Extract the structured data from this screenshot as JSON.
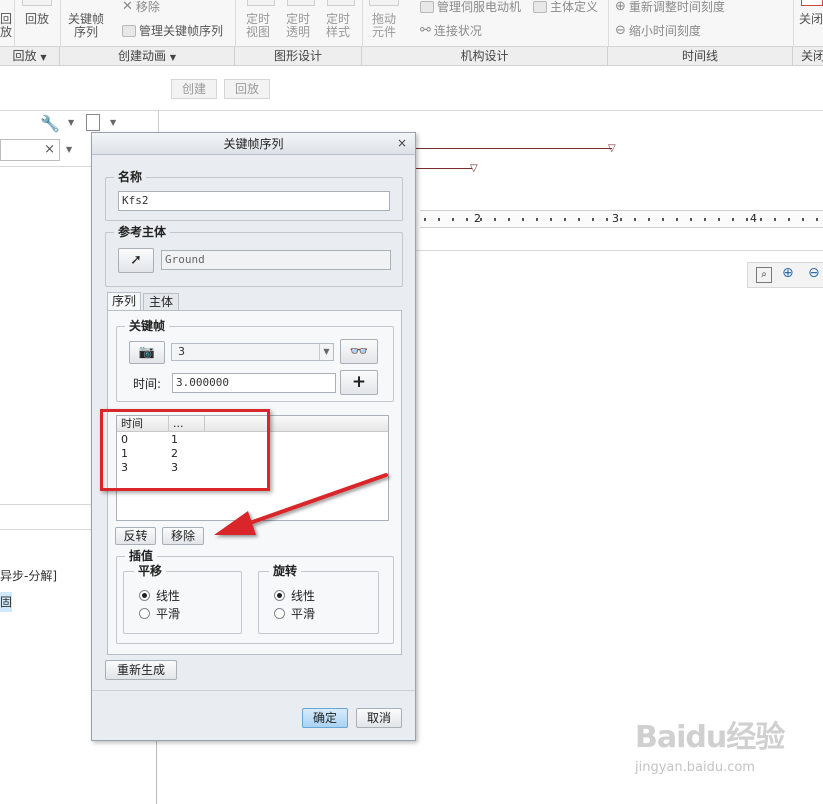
{
  "ribbon": {
    "playback_top": "回\n放",
    "playback": "回放",
    "keyframe_seq": "关键帧\n序列",
    "remove": "移除",
    "manage_keyframe_seq": "管理关键帧序列",
    "fixed_view": "定时\n视图",
    "fixed_transparency": "定时\n透明",
    "fixed_style": "定时\n样式",
    "drag_component": "拖动\n元件",
    "manage_servo": "管理伺服电动机",
    "body_def": "主体定义",
    "connection_status": "连接状况",
    "rescale_time": "重新调整时间刻度",
    "shrink_time": "缩小时间刻度",
    "close": "关闭",
    "groups": [
      "回放",
      "创建动画",
      "图形设计",
      "机构设计",
      "时间线",
      "关闭"
    ]
  },
  "toolbar2": {
    "create": "创建",
    "playback": "回放"
  },
  "left": {
    "text1": "异步-分解]",
    "text2": "固"
  },
  "timeline": {
    "ticks": [
      "2",
      "3",
      "4"
    ]
  },
  "dialog": {
    "title": "关键帧序列",
    "close_glyph": "×",
    "name_label": "名称",
    "name_value": "Kfs2",
    "ref_label": "参考主体",
    "ref_value": "Ground",
    "tabs": [
      "序列",
      "主体"
    ],
    "keyframe_label": "关键帧",
    "keyframe_value": "3",
    "time_label": "时间:",
    "time_value": "3.000000",
    "table": {
      "headers": [
        "时间",
        "..."
      ],
      "rows": [
        [
          "0",
          "1"
        ],
        [
          "1",
          "2"
        ],
        [
          "3",
          "3"
        ]
      ]
    },
    "reverse": "反转",
    "remove": "移除",
    "interp_label": "插值",
    "translation_label": "平移",
    "rotation_label": "旋转",
    "linear": "线性",
    "smooth": "平滑",
    "regenerate": "重新生成",
    "ok": "确定",
    "cancel": "取消"
  },
  "watermark": {
    "logo": "Baidu经验",
    "url": "jingyan.baidu.com"
  },
  "colors": {
    "annotation": "#d9262a",
    "primary_button": "#a9d2f2"
  }
}
